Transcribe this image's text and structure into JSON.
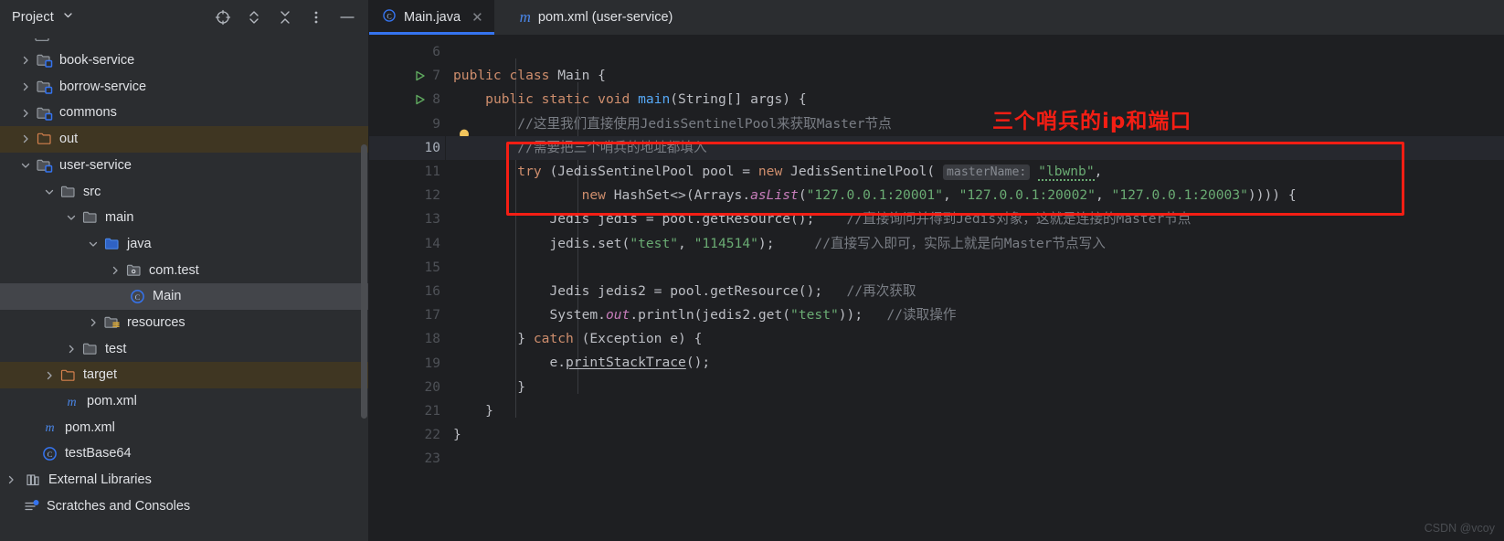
{
  "sidebar": {
    "title": "Project",
    "title_chevron_icon": "chevron-down-icon",
    "tools": [
      {
        "name": "locate-icon",
        "glyph": "target"
      },
      {
        "name": "expand-collapse-icon",
        "glyph": "updown"
      },
      {
        "name": "collapse-all-icon",
        "glyph": "collapse"
      },
      {
        "name": "more-options-icon",
        "glyph": "kebab"
      },
      {
        "name": "minimize-icon",
        "glyph": "minus"
      }
    ],
    "items": [
      {
        "label": "book-service",
        "icon": "module-folder-icon",
        "arrow": "collapsed",
        "indent": 1,
        "state": "none"
      },
      {
        "label": "borrow-service",
        "icon": "module-folder-icon",
        "arrow": "collapsed",
        "indent": 1,
        "state": "none"
      },
      {
        "label": "commons",
        "icon": "module-folder-icon",
        "arrow": "collapsed",
        "indent": 1,
        "state": "none"
      },
      {
        "label": "out",
        "icon": "excluded-folder-icon",
        "arrow": "collapsed",
        "indent": 1,
        "state": "brown"
      },
      {
        "label": "user-service",
        "icon": "module-folder-icon",
        "arrow": "expanded",
        "indent": 1,
        "state": "none"
      },
      {
        "label": "src",
        "icon": "folder-icon",
        "arrow": "expanded",
        "indent": 2,
        "state": "none"
      },
      {
        "label": "main",
        "icon": "folder-icon",
        "arrow": "expanded",
        "indent": 3,
        "state": "none"
      },
      {
        "label": "java",
        "icon": "source-root-folder-icon",
        "arrow": "expanded",
        "indent": 4,
        "state": "none"
      },
      {
        "label": "com.test",
        "icon": "package-icon",
        "arrow": "collapsed",
        "indent": 5,
        "state": "none"
      },
      {
        "label": "Main",
        "icon": "java-class-icon",
        "arrow": "none",
        "indent": 6,
        "state": "blue"
      },
      {
        "label": "resources",
        "icon": "resources-folder-icon",
        "arrow": "collapsed",
        "indent": 4,
        "state": "none"
      },
      {
        "label": "test",
        "icon": "folder-icon",
        "arrow": "collapsed",
        "indent": 3,
        "state": "none"
      },
      {
        "label": "target",
        "icon": "excluded-folder-icon",
        "arrow": "collapsed",
        "indent": 2,
        "state": "brown"
      },
      {
        "label": "pom.xml",
        "icon": "maven-icon",
        "arrow": "none",
        "indent": 3,
        "state": "none"
      },
      {
        "label": "pom.xml",
        "icon": "maven-icon",
        "arrow": "none",
        "indent": 2,
        "state": "none"
      },
      {
        "label": "testBase64",
        "icon": "java-class-icon",
        "arrow": "none",
        "indent": 2,
        "state": "none"
      },
      {
        "label": "External Libraries",
        "icon": "library-icon",
        "arrow": "collapsed",
        "indent": 0,
        "state": "none"
      },
      {
        "label": "Scratches and Consoles",
        "icon": "scratches-icon",
        "arrow": "none",
        "indent": 1,
        "state": "none"
      }
    ]
  },
  "tabs": [
    {
      "label": "Main.java",
      "icon": "java-class-icon",
      "active": true,
      "closable": true
    },
    {
      "label": "pom.xml (user-service)",
      "icon": "maven-icon",
      "active": false,
      "closable": false
    }
  ],
  "editor": {
    "first_line": 6,
    "current_line": 10,
    "lines": [
      {
        "n": 6,
        "run": false,
        "bulb": false
      },
      {
        "n": 7,
        "run": true,
        "bulb": false
      },
      {
        "n": 8,
        "run": true,
        "bulb": false
      },
      {
        "n": 9,
        "run": false,
        "bulb": false
      },
      {
        "n": 10,
        "run": false,
        "bulb": true
      },
      {
        "n": 11,
        "run": false,
        "bulb": false
      },
      {
        "n": 12,
        "run": false,
        "bulb": false
      },
      {
        "n": 13,
        "run": false,
        "bulb": false
      },
      {
        "n": 14,
        "run": false,
        "bulb": false
      },
      {
        "n": 15,
        "run": false,
        "bulb": false
      },
      {
        "n": 16,
        "run": false,
        "bulb": false
      },
      {
        "n": 17,
        "run": false,
        "bulb": false
      },
      {
        "n": 18,
        "run": false,
        "bulb": false
      },
      {
        "n": 19,
        "run": false,
        "bulb": false
      },
      {
        "n": 20,
        "run": false,
        "bulb": false
      },
      {
        "n": 21,
        "run": false,
        "bulb": false
      },
      {
        "n": 22,
        "run": false,
        "bulb": false
      },
      {
        "n": 23,
        "run": false,
        "bulb": false
      }
    ],
    "code": {
      "l6": "",
      "l7_kw": "public class",
      "l7_name": " Main {",
      "l8_kw1": "public static void ",
      "l8_method": "main",
      "l8_rest": "(String[] args) {",
      "l9_comment": "//这里我们直接使用JedisSentinelPool来获取Master节点",
      "l10_comment": "//需要把三个哨兵的地址都填入",
      "l11_try": "try",
      "l11_a": " (JedisSentinelPool pool = ",
      "l11_new": "new",
      "l11_b": " JedisSentinelPool( ",
      "l11_hint": "masterName:",
      "l11_str": "\"lbwnb\"",
      "l11_c": ",",
      "l12_new": "new",
      "l12_a": " HashSet<>(Arrays.",
      "l12_aslist": "asList",
      "l12_b": "(",
      "l12_s1": "\"127.0.0.1:20001\"",
      "l12_c1": ", ",
      "l12_s2": "\"127.0.0.1:20002\"",
      "l12_c2": ", ",
      "l12_s3": "\"127.0.0.1:20003\"",
      "l12_d": ")))) {",
      "l13_code": "Jedis jedis = pool.getResource();",
      "l13_comment": "//直接询问并得到Jedis对象，这就是连接的Master节点",
      "l14_a": "jedis.set(",
      "l14_s1": "\"test\"",
      "l14_b": ", ",
      "l14_s2": "\"114514\"",
      "l14_c": ");",
      "l14_comment": "//直接写入即可，实际上就是向Master节点写入",
      "l16_code": "Jedis jedis2 = pool.getResource();",
      "l16_comment": "//再次获取",
      "l17_a": "System.",
      "l17_out": "out",
      "l17_b": ".println(jedis2.get(",
      "l17_s": "\"test\"",
      "l17_c": "));",
      "l17_comment": "//读取操作",
      "l18_a": "} ",
      "l18_catch": "catch",
      "l18_b": " (Exception e) {",
      "l19_a": "e.",
      "l19_method": "printStackTrace",
      "l19_b": "();",
      "l20": "}",
      "l21": "}",
      "l22": "}",
      "l23": ""
    }
  },
  "annotation": {
    "note_text": "三个哨兵的ip和端口",
    "note_color": "#f41e14",
    "box_color": "#f41e14"
  },
  "watermark": {
    "text": "CSDN @vcoy"
  },
  "colors": {
    "sidebar_bg": "#2b2d30",
    "editor_bg": "#1e1f22",
    "accent_blue": "#3574f0",
    "keyword": "#cf8e6d",
    "string": "#6aab73",
    "comment": "#7a7e85",
    "method": "#56a8f5",
    "selection_blue": "#43454a",
    "selection_brown": "#3f3622"
  }
}
